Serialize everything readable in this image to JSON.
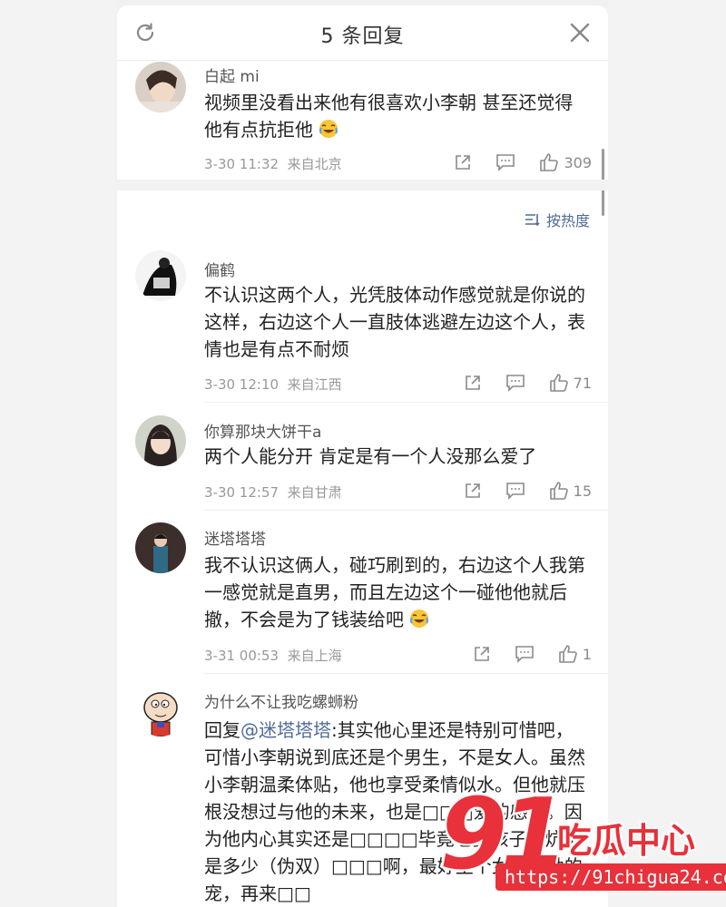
{
  "header": {
    "title": "5 条回复"
  },
  "sort_label": "按热度",
  "top_comment": {
    "name": "白起 mi",
    "text": "视频里没看出来他有很喜欢小李朝 甚至还觉得他有点抗拒他",
    "time": "3-30 11:32",
    "location": "来自北京",
    "likes": "309"
  },
  "replies": [
    {
      "name": "偏鹤",
      "text": "不认识这两个人，光凭肢体动作感觉就是你说的这样，右边这个人一直肢体逃避左边这个人，表情也是有点不耐烦",
      "time": "3-30 12:10",
      "location": "来自江西",
      "likes": "71"
    },
    {
      "name": "你算那块大饼干a",
      "text": "两个人能分开 肯定是有一个人没那么爱了",
      "time": "3-30 12:57",
      "location": "来自甘肃",
      "likes": "15"
    },
    {
      "name": "迷塔塔塔",
      "text": "我不认识这俩人，碰巧刷到的，右边这个人我第一感觉就是直男，而且左边这个一碰他他就后撤，不会是为了钱装给吧",
      "time": "3-31 00:53",
      "location": "来自上海",
      "likes": "1"
    },
    {
      "name": "为什么不让我吃螺蛳粉",
      "reply_prefix": "回复",
      "mention": "@迷塔塔塔",
      "text": ":其实他心里还是特别可惜吧，可惜小李朝说到底还是个男生，不是女人。虽然小李朝温柔体贴，他也享受柔情似水。但他就压根没想过与他的未来，也是□□□爱的感觉。因为他内心其实还是□□□□毕竟老婆孩子热炕头是多少（伪双）□□□啊，最好生个女儿使劲的宠，再来□□"
    }
  ],
  "watermark": {
    "number": "91",
    "brand": "吃瓜中心",
    "url": "https://91chigua24.com"
  },
  "colors": {
    "accent": "#4f6b98",
    "watermark": "#e8313a"
  }
}
